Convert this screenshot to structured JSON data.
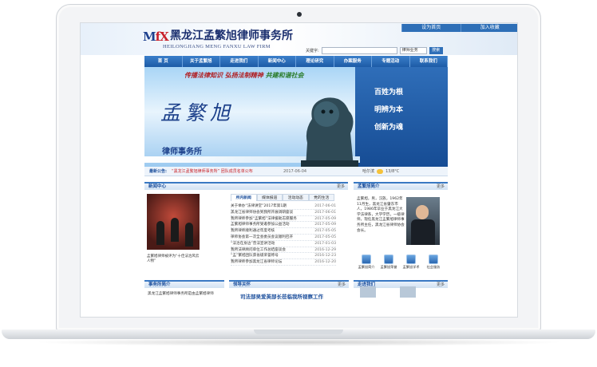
{
  "header": {
    "logo_mark_a": "M",
    "logo_mark_b": "f",
    "logo_mark_c": "X",
    "firm_name_cn": "黑龙江孟繁旭律师事务所",
    "firm_name_en": "HEILONGJIANG MENG FANXU LAW FIRM",
    "top_buttons": [
      "设为首页",
      "加入收藏"
    ],
    "search_label": "关键字:",
    "search_placeholder": "",
    "search_scope": "律师业务",
    "search_button": "搜索"
  },
  "nav": {
    "items": [
      "首 页",
      "关于孟繁旭",
      "走进我们",
      "新闻中心",
      "理论研究",
      "办案服务",
      "专题活动",
      "联系我们"
    ]
  },
  "banner": {
    "slogan_a": "传播法律知识 弘扬法制精神",
    "slogan_b": "共建和谐社会",
    "name": "孟繁旭",
    "firm": "律师事务所",
    "mottos": [
      "百姓为根",
      "明辨为本",
      "创新为魂"
    ]
  },
  "notice": {
    "label": "最新公告:",
    "text": "“黑龙江孟繁旭律师事务所” 团队成员名单公布",
    "date": "2017-06-04",
    "weather_label": "哈尔滨",
    "weather": "13/8°C"
  },
  "news": {
    "title": "新闻中心",
    "more": "更多",
    "photo_caption": "孟繁旭律师被评为“十佳法治风云人物”",
    "tabs": [
      "所内新闻",
      "媒体报道",
      "活动动态",
      "党的生活"
    ],
    "rows": [
      {
        "title": "关于举办“法律讲堂”2017年第1期",
        "date": "2017-06-01"
      },
      {
        "title": "黑龙江省律师协会到我所开展调研座谈",
        "date": "2017-06-01"
      },
      {
        "title": "我所律师参加“孟繁旭”法律援助志愿服务",
        "date": "2017-05-09"
      },
      {
        "title": "孟繁旭律师事务所受邀参加公益活动",
        "date": "2017-05-09"
      },
      {
        "title": "我所律师顺利通过年度考核",
        "date": "2017-05-05"
      },
      {
        "title": "律师协会第一次全会委员会议顺利召开",
        "date": "2017-05-05"
      },
      {
        "title": "“法治在身边”普法宣讲活动",
        "date": "2017-01-03"
      },
      {
        "title": "我所法律顾问单位工作总结座谈会",
        "date": "2016-12-29"
      },
      {
        "title": "“孟”繁旭团队获省级荣誉称号",
        "date": "2016-12-23"
      },
      {
        "title": "我所律师参加黑龙江省律师论坛",
        "date": "2016-12-20"
      }
    ]
  },
  "profile": {
    "title": "孟繁旭简介",
    "more": "更多",
    "text": "孟繁旭，男，汉族，1962年11月生，黑龙江省肇东市人，1986年毕业于黑龙江大学法律系，大学学历，一级律师，现任黑龙江孟繁旭律师事务所主任，黑龙江省律师协会会长。",
    "icons": [
      {
        "label": "孟繁旭简介"
      },
      {
        "label": "孟繁旭荣誉"
      },
      {
        "label": "孟繁旭学术"
      },
      {
        "label": "社会服务"
      }
    ]
  },
  "bottom": {
    "intro_title": "事务所简介",
    "intro_text": "黑龙江孟繁旭律师事务所是由孟繁旭律师",
    "honor_title": "领导关怀",
    "honor_headline": "司法部吴爱英部长莅临我所视察工作",
    "visit_title": "走进我们",
    "more": "更多"
  },
  "colors": {
    "primary": "#1d5ba6",
    "accent_red": "#c8202a",
    "panel_border": "#3a79c3"
  }
}
